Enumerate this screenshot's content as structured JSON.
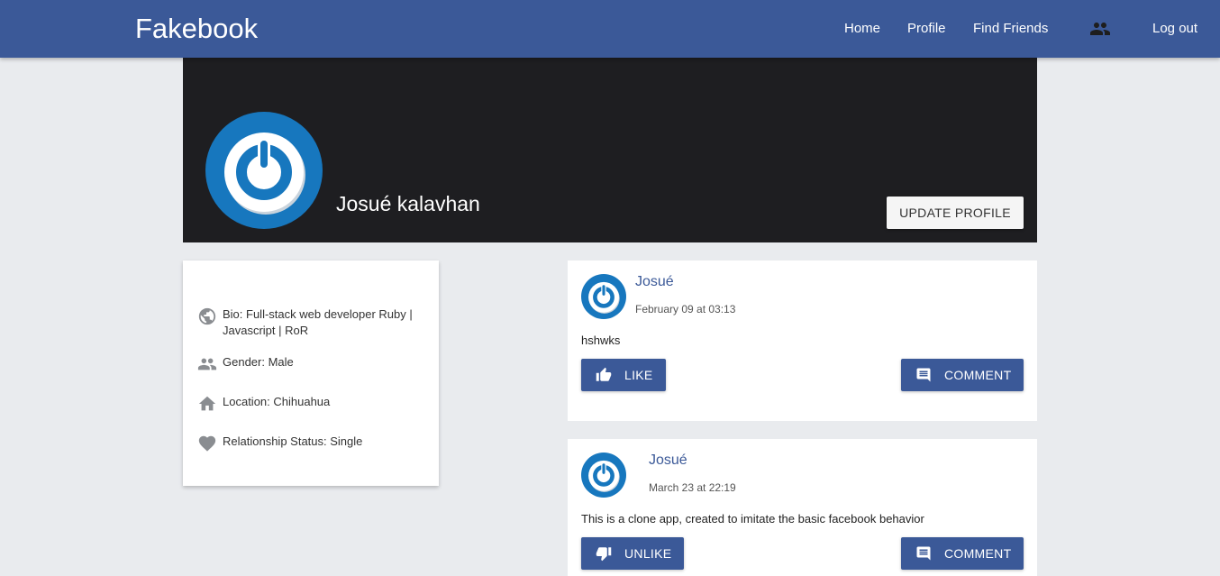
{
  "nav": {
    "brand": "Fakebook",
    "links": [
      "Home",
      "Profile",
      "Find Friends"
    ],
    "friends_icon": "people-icon",
    "logout": "Log out"
  },
  "colors": {
    "brand": "#3b5998",
    "cover": "#1e1e21",
    "avatar_blue": "#1777be",
    "background": "#e9ebee"
  },
  "profile": {
    "name": "Josué kalavhan",
    "update_button": "UPDATE PROFILE",
    "avatar_icon": "power-button-avatar"
  },
  "info": {
    "bio": "Bio: Full-stack web developer Ruby | Javascript | RoR",
    "gender": "Gender: Male",
    "location": "Location: Chihuahua",
    "relationship": "Relationship Status: Single",
    "icons": [
      "globe-icon",
      "people-icon",
      "home-icon",
      "heart-icon"
    ]
  },
  "posts": [
    {
      "author": "Josué",
      "time": "February 09 at 03:13",
      "body": "hshwks",
      "like_label": "LIKE",
      "like_icon": "thumb-up-icon",
      "comment_label": "COMMENT"
    },
    {
      "author": "Josué",
      "time": "March 23 at 22:19",
      "body": "This is a clone app, created to imitate the basic facebook behavior",
      "like_label": "UNLIKE",
      "like_icon": "thumb-down-icon",
      "comment_label": "COMMENT"
    }
  ]
}
